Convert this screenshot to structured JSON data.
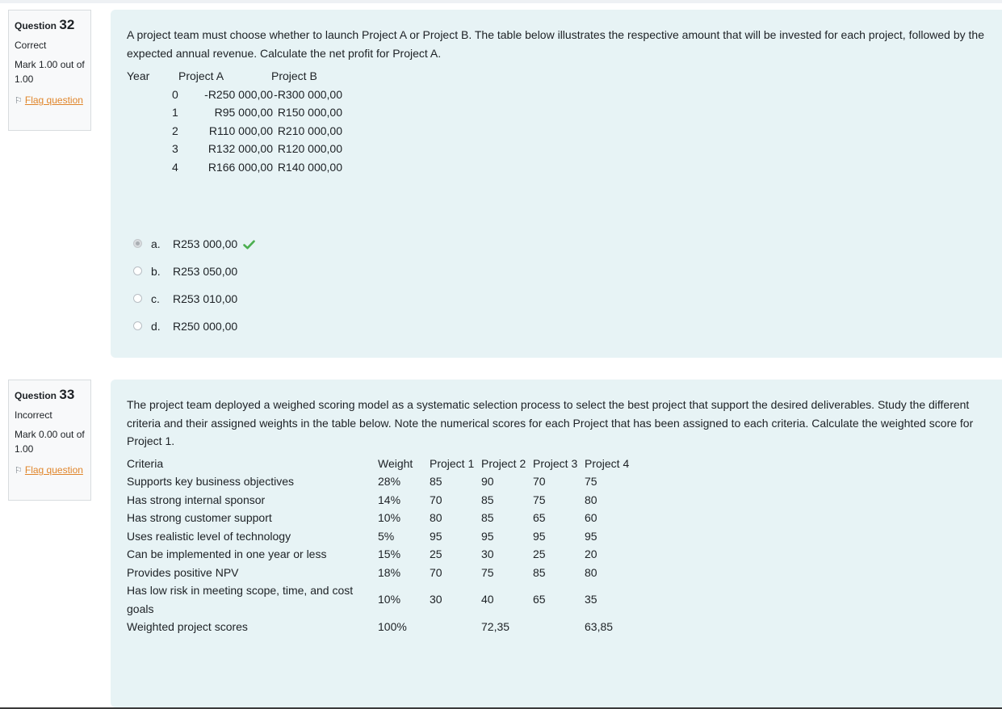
{
  "q32": {
    "info": {
      "label": "Question",
      "number": "32",
      "state": "Correct",
      "grade": "Mark 1.00 out of 1.00",
      "flag": "Flag question"
    },
    "text": "A project team must choose whether to launch Project A or Project B. The table below illustrates the respective amount that will be invested for each project, followed by the expected annual revenue. Calculate the net profit for Project A.",
    "table": {
      "headers": [
        "Year",
        "Project A",
        "Project B"
      ],
      "rows": [
        [
          "0",
          "-R250 000,00",
          "-R300 000,00"
        ],
        [
          "1",
          "R95 000,00",
          "R150 000,00"
        ],
        [
          "2",
          "R110 000,00",
          "R210 000,00"
        ],
        [
          "3",
          "R132 000,00",
          "R120 000,00"
        ],
        [
          "4",
          "R166 000,00",
          "R140 000,00"
        ]
      ]
    },
    "answers": [
      {
        "letter": "a.",
        "text": "R253 000,00",
        "selected": true,
        "correct": true
      },
      {
        "letter": "b.",
        "text": "R253 050,00",
        "selected": false,
        "correct": false
      },
      {
        "letter": "c.",
        "text": "R253 010,00",
        "selected": false,
        "correct": false
      },
      {
        "letter": "d.",
        "text": "R250 000,00",
        "selected": false,
        "correct": false
      }
    ]
  },
  "q33": {
    "info": {
      "label": "Question",
      "number": "33",
      "state": "Incorrect",
      "grade": "Mark 0.00 out of 1.00",
      "flag": "Flag question"
    },
    "text": "The project team deployed a weighed scoring model as a systematic selection process to select the best project that support the desired deliverables. Study the different criteria and their assigned weights in the table below. Note the numerical scores for each Project that has been assigned to each criteria. Calculate the weighted score for Project 1.",
    "table": {
      "headers": [
        "Criteria",
        "Weight",
        "Project 1",
        "Project 2",
        "Project 3",
        "Project 4"
      ],
      "rows": [
        [
          "Supports key business objectives",
          "28%",
          "85",
          "90",
          "70",
          "75"
        ],
        [
          "Has strong internal sponsor",
          "14%",
          "70",
          "85",
          "75",
          "80"
        ],
        [
          "Has strong customer support",
          "10%",
          "80",
          "85",
          "65",
          "60"
        ],
        [
          "Uses realistic level of technology",
          "5%",
          "95",
          "95",
          "95",
          "95"
        ],
        [
          "Can be implemented in one year or less",
          "15%",
          "25",
          "30",
          "25",
          "20"
        ],
        [
          "Provides positive NPV",
          "18%",
          "70",
          "75",
          "85",
          "80"
        ],
        [
          "Has low risk in meeting scope, time, and cost goals",
          "10%",
          "30",
          "40",
          "65",
          "35"
        ],
        [
          "Weighted project scores",
          "100%",
          "",
          "72,35",
          "",
          "63,85"
        ]
      ]
    }
  },
  "colors": {
    "content_bg": "#e7f3f5",
    "flag_link": "#e0852a",
    "correct_tick": "#4caf50"
  }
}
